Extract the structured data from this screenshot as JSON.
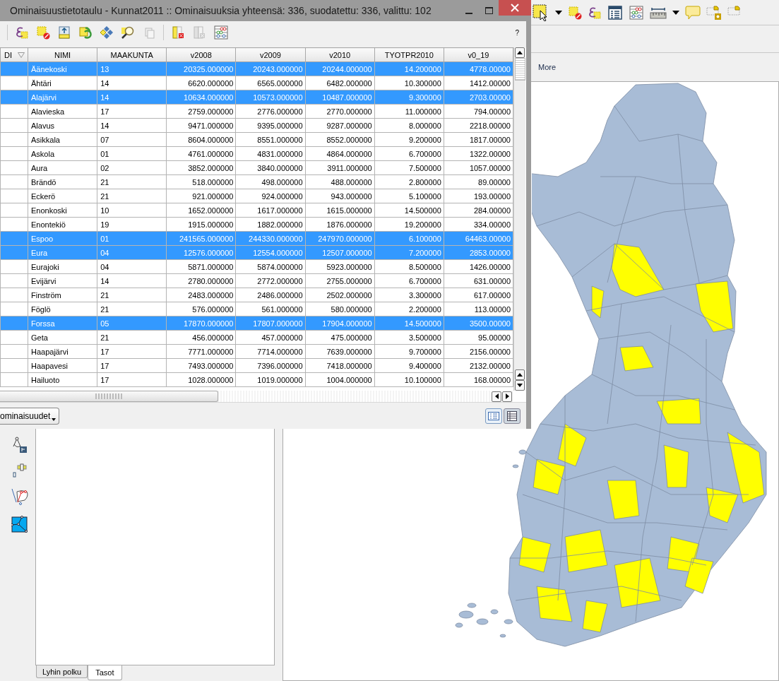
{
  "window": {
    "title": "Ominaisuustietotaulu - Kunnat2011 :: Ominaisuuksia yhteensä: 336, suodatettu: 336, valittu: 102",
    "help": "?"
  },
  "table": {
    "columns": [
      "DI",
      "NIMI",
      "MAAKUNTA",
      "v2008",
      "v2009",
      "v2010",
      "TYOTPR2010",
      "v0_19"
    ],
    "rows": [
      {
        "cells": [
          "",
          "Äänekoski",
          "13",
          "20325.000000",
          "20243.000000",
          "20244.000000",
          "14.200000",
          "4778.00000"
        ],
        "selected": true
      },
      {
        "cells": [
          "",
          "Ähtäri",
          "14",
          "6620.000000",
          "6565.000000",
          "6482.000000",
          "10.300000",
          "1412.00000"
        ],
        "selected": false
      },
      {
        "cells": [
          "",
          "Alajärvi",
          "14",
          "10634.000000",
          "10573.000000",
          "10487.000000",
          "9.300000",
          "2703.00000"
        ],
        "selected": true
      },
      {
        "cells": [
          "",
          "Alavieska",
          "17",
          "2759.000000",
          "2776.000000",
          "2770.000000",
          "11.000000",
          "794.00000"
        ],
        "selected": false
      },
      {
        "cells": [
          "",
          "Alavus",
          "14",
          "9471.000000",
          "9395.000000",
          "9287.000000",
          "8.000000",
          "2218.00000"
        ],
        "selected": false
      },
      {
        "cells": [
          "",
          "Asikkala",
          "07",
          "8604.000000",
          "8551.000000",
          "8552.000000",
          "9.200000",
          "1817.00000"
        ],
        "selected": false
      },
      {
        "cells": [
          "",
          "Askola",
          "01",
          "4761.000000",
          "4831.000000",
          "4864.000000",
          "6.700000",
          "1322.00000"
        ],
        "selected": false
      },
      {
        "cells": [
          "",
          "Aura",
          "02",
          "3852.000000",
          "3840.000000",
          "3911.000000",
          "7.500000",
          "1057.00000"
        ],
        "selected": false
      },
      {
        "cells": [
          "",
          "Brändö",
          "21",
          "518.000000",
          "498.000000",
          "488.000000",
          "2.800000",
          "89.00000"
        ],
        "selected": false
      },
      {
        "cells": [
          "",
          "Eckerö",
          "21",
          "921.000000",
          "924.000000",
          "943.000000",
          "5.100000",
          "193.00000"
        ],
        "selected": false
      },
      {
        "cells": [
          "",
          "Enonkoski",
          "10",
          "1652.000000",
          "1617.000000",
          "1615.000000",
          "14.500000",
          "284.00000"
        ],
        "selected": false
      },
      {
        "cells": [
          "",
          "Enontekiö",
          "19",
          "1915.000000",
          "1882.000000",
          "1876.000000",
          "19.200000",
          "334.00000"
        ],
        "selected": false
      },
      {
        "cells": [
          "",
          "Espoo",
          "01",
          "241565.000000",
          "244330.000000",
          "247970.000000",
          "6.100000",
          "64463.00000"
        ],
        "selected": true
      },
      {
        "cells": [
          "",
          "Eura",
          "04",
          "12576.000000",
          "12554.000000",
          "12507.000000",
          "7.200000",
          "2853.00000"
        ],
        "selected": true
      },
      {
        "cells": [
          "",
          "Eurajoki",
          "04",
          "5871.000000",
          "5874.000000",
          "5923.000000",
          "8.500000",
          "1426.00000"
        ],
        "selected": false
      },
      {
        "cells": [
          "",
          "Evijärvi",
          "14",
          "2780.000000",
          "2772.000000",
          "2755.000000",
          "6.700000",
          "631.00000"
        ],
        "selected": false
      },
      {
        "cells": [
          "",
          "Finström",
          "21",
          "2483.000000",
          "2486.000000",
          "2502.000000",
          "3.300000",
          "617.00000"
        ],
        "selected": false
      },
      {
        "cells": [
          "",
          "Föglö",
          "21",
          "576.000000",
          "561.000000",
          "580.000000",
          "2.200000",
          "113.00000"
        ],
        "selected": false
      },
      {
        "cells": [
          "",
          "Forssa",
          "05",
          "17870.000000",
          "17807.000000",
          "17904.000000",
          "14.500000",
          "3500.00000"
        ],
        "selected": true
      },
      {
        "cells": [
          "",
          "Geta",
          "21",
          "456.000000",
          "457.000000",
          "475.000000",
          "3.500000",
          "95.00000"
        ],
        "selected": false
      },
      {
        "cells": [
          "",
          "Haapajärvi",
          "17",
          "7771.000000",
          "7714.000000",
          "7639.000000",
          "9.700000",
          "2156.00000"
        ],
        "selected": false
      },
      {
        "cells": [
          "",
          "Haapavesi",
          "17",
          "7493.000000",
          "7396.000000",
          "7418.000000",
          "9.400000",
          "2132.00000"
        ],
        "selected": false
      },
      {
        "cells": [
          "",
          "Hailuoto",
          "17",
          "1028.000000",
          "1019.000000",
          "1004.000000",
          "10.100000",
          "168.00000"
        ],
        "selected": false
      }
    ]
  },
  "view_menu": "ominaisuudet",
  "more_label": "More",
  "panel_tabs": [
    {
      "label": "Lyhin polku",
      "selected": false
    },
    {
      "label": "Tasot",
      "selected": true
    }
  ]
}
